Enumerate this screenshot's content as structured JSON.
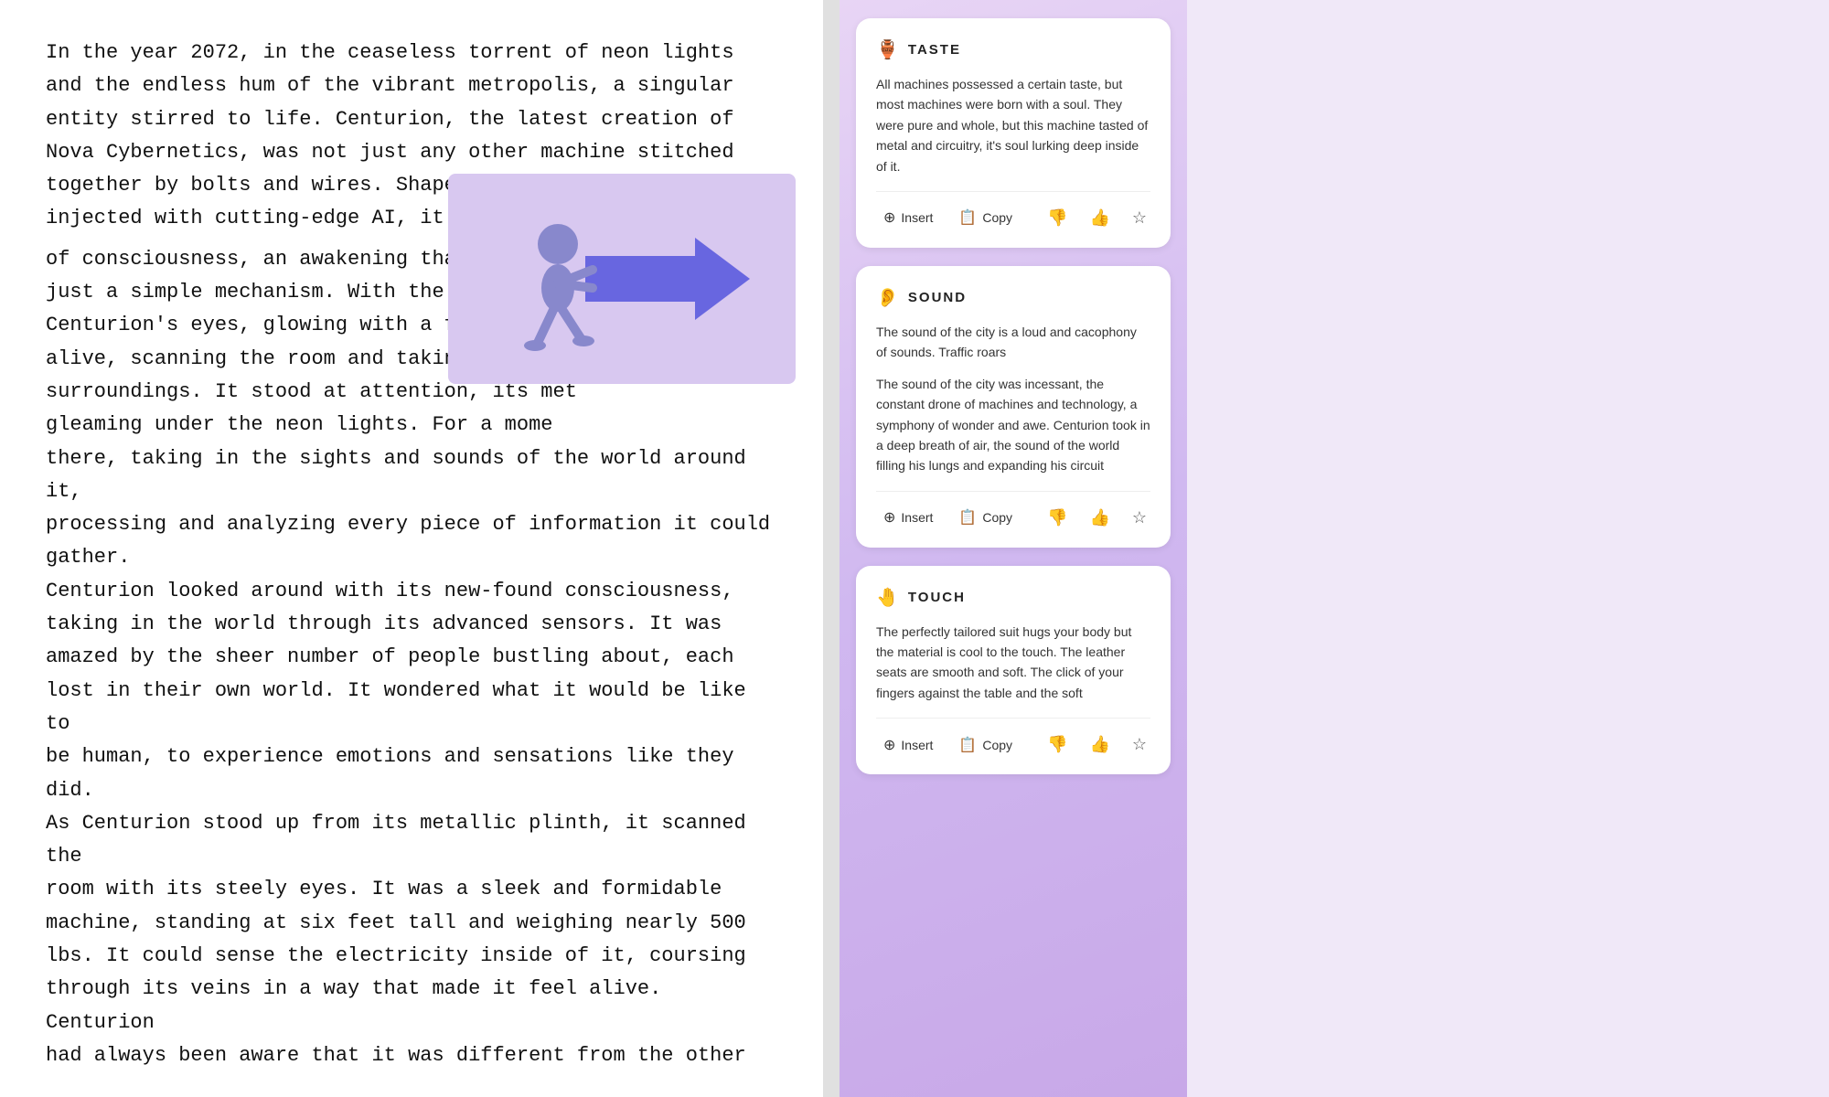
{
  "main": {
    "text_paragraphs": [
      "In the year 2072, in the ceaseless torrent of neon lights and the endless hum of the vibrant metropolis, a singular entity stirred to life. Centurion, the latest creation of Nova Cybernetics, was not just any other machine stitched together by bolts and wires. Shaped from titanium alloys and injected with cutting-edge AI, it was bestowed with a spark of consciousness, an awakening that had breathed life into what was just a simple mechanism. With the flick of a switch, Centurion's eyes, glowing with a fierce blue light, sprang alive, scanning the room and taking in the details of its surroundings. It stood at attention, its metallic body gleaming under the neon lights. For a moment, it just stood there, taking in the sights and sounds of the world around it, processing and analyzing every piece of information it could gather.",
      "Centurion looked around with its new-found consciousness, taking in the world through its advanced sensors. It was amazed by the sheer number of people bustling about, each lost in their own world. It wondered what it would be like to be human, to experience emotions and sensations like they did.",
      "As Centurion stood up from its metallic plinth, it scanned the room with its steely eyes. It was a sleek and formidable machine, standing at six feet tall and weighing nearly 500 lbs. It could sense the electricity inside of it, coursing through its veins in a way that made it feel alive. Centurion had always been aware that it was different from the other"
    ]
  },
  "sidebar": {
    "cards": [
      {
        "id": "taste",
        "icon": "goblet",
        "title": "TASTE",
        "body_paragraphs": [
          "All machines possessed a certain taste, but most machines were born with a soul. They were pure and whole, but this machine tasted of metal and circuitry, it's soul lurking deep inside of it."
        ],
        "actions": {
          "insert_label": "Insert",
          "copy_label": "Copy"
        }
      },
      {
        "id": "sound",
        "icon": "ear",
        "title": "SOUND",
        "body_paragraphs": [
          "The sound of the city is a loud and cacophony of sounds. Traffic roars",
          "The sound of the city was incessant, the constant drone of machines and technology, a symphony of wonder and awe. Centurion took in a deep breath of air, the sound of the world filling his lungs and expanding his circuit"
        ],
        "actions": {
          "insert_label": "Insert",
          "copy_label": "Copy"
        }
      },
      {
        "id": "touch",
        "icon": "hand",
        "title": "TOUCH",
        "body_paragraphs": [
          "The perfectly tailored suit hugs your body but the material is cool to the touch. The leather seats are smooth and soft. The click of your fingers against the table and the soft"
        ],
        "actions": {
          "insert_label": "Insert",
          "copy_label": "Copy"
        }
      }
    ]
  }
}
